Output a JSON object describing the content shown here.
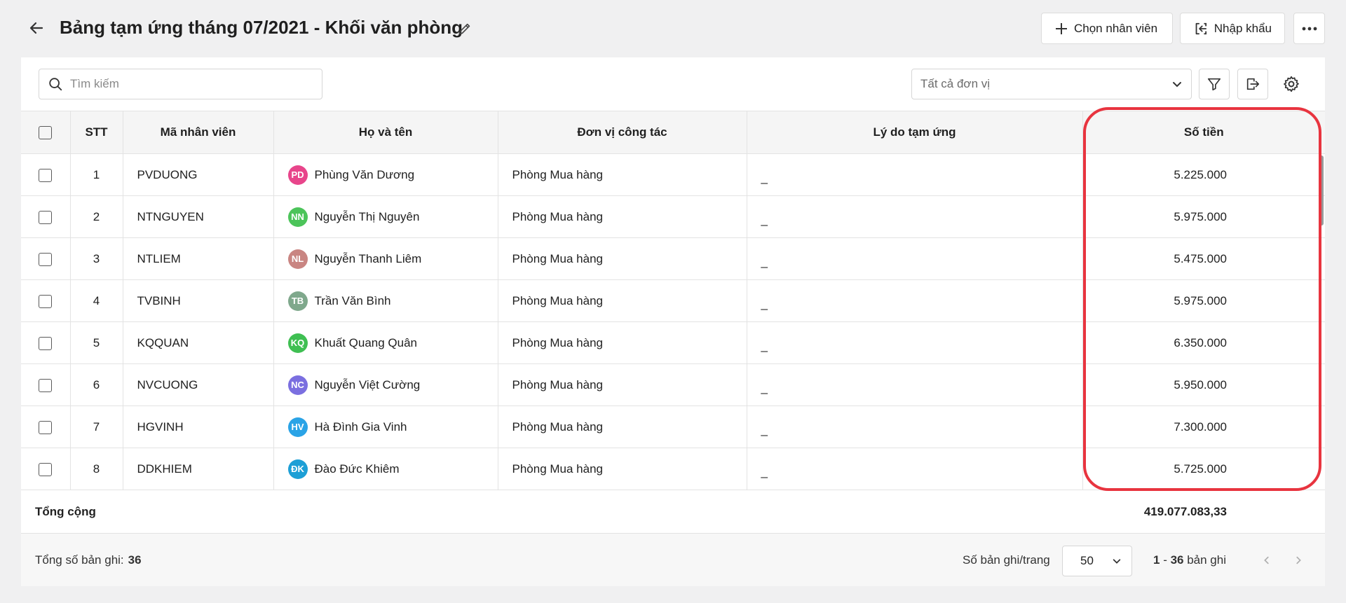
{
  "header": {
    "title": "Bảng tạm ứng tháng 07/2021 - Khối văn phòng",
    "choose_employee_label": "Chọn nhân viên",
    "import_label": "Nhập khẩu"
  },
  "toolbar": {
    "search_placeholder": "Tìm kiếm",
    "unit_filter_value": "Tất cả đơn vị"
  },
  "table": {
    "columns": {
      "stt": "STT",
      "code": "Mã nhân viên",
      "name": "Họ và tên",
      "unit": "Đơn vị công tác",
      "reason": "Lý do tạm ứng",
      "amount": "Số tiền"
    },
    "rows": [
      {
        "stt": "1",
        "code": "PVDUONG",
        "initials": "PD",
        "avatar_color": "#e8458b",
        "name": "Phùng Văn Dương",
        "unit": "Phòng Mua hàng",
        "reason": "_",
        "amount": "5.225.000"
      },
      {
        "stt": "2",
        "code": "NTNGUYEN",
        "initials": "NN",
        "avatar_color": "#4cc45a",
        "name": "Nguyễn Thị Nguyên",
        "unit": "Phòng Mua hàng",
        "reason": "_",
        "amount": "5.975.000"
      },
      {
        "stt": "3",
        "code": "NTLIEM",
        "initials": "NL",
        "avatar_color": "#c98582",
        "name": "Nguyễn Thanh Liêm",
        "unit": "Phòng Mua hàng",
        "reason": "_",
        "amount": "5.475.000"
      },
      {
        "stt": "4",
        "code": "TVBINH",
        "initials": "TB",
        "avatar_color": "#7fa88c",
        "name": "Trần Văn Bình",
        "unit": "Phòng Mua hàng",
        "reason": "_",
        "amount": "5.975.000"
      },
      {
        "stt": "5",
        "code": "KQQUAN",
        "initials": "KQ",
        "avatar_color": "#3fbf52",
        "name": "Khuất Quang Quân",
        "unit": "Phòng Mua hàng",
        "reason": "_",
        "amount": "6.350.000"
      },
      {
        "stt": "6",
        "code": "NVCUONG",
        "initials": "NC",
        "avatar_color": "#7b6fe0",
        "name": "Nguyễn Việt Cường",
        "unit": "Phòng Mua hàng",
        "reason": "_",
        "amount": "5.950.000"
      },
      {
        "stt": "7",
        "code": "HGVINH",
        "initials": "HV",
        "avatar_color": "#2aa3e6",
        "name": "Hà Đình Gia Vinh",
        "unit": "Phòng Mua hàng",
        "reason": "_",
        "amount": "7.300.000"
      },
      {
        "stt": "8",
        "code": "DDKHIEM",
        "initials": "ĐK",
        "avatar_color": "#1d9fd6",
        "name": "Đào Đức Khiêm",
        "unit": "Phòng Mua hàng",
        "reason": "_",
        "amount": "5.725.000"
      }
    ]
  },
  "totals": {
    "label": "Tổng cộng",
    "amount": "419.077.083,33"
  },
  "footer": {
    "records_label": "Tổng số bản ghi:",
    "records_count": "36",
    "per_page_label": "Số bản ghi/trang",
    "per_page_value": "50",
    "range_from": "1",
    "range_sep": " - ",
    "range_to": "36",
    "range_suffix": " bản ghi"
  }
}
